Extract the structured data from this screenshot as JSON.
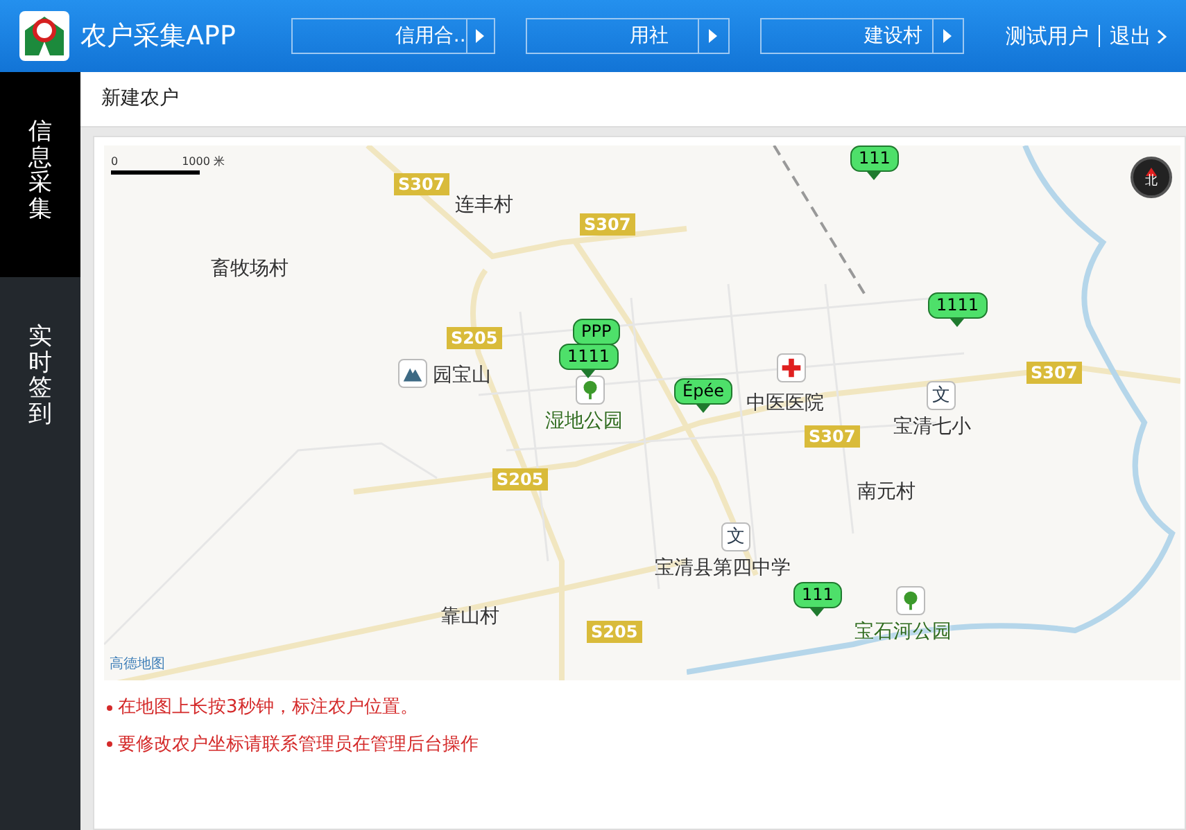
{
  "header": {
    "title": "农户采集APP",
    "selects": [
      {
        "value": "信用合.."
      },
      {
        "value": "用社"
      },
      {
        "value": "建设村"
      }
    ],
    "user": "测试用户",
    "logout": "退出"
  },
  "sidebar": {
    "items": [
      {
        "label": "信息采集",
        "selected": true
      },
      {
        "label": "实时签到",
        "selected": false
      }
    ]
  },
  "breadcrumb": "新建农户",
  "map": {
    "scale_start": "0",
    "scale_end": "1000 米",
    "compass": "北",
    "attribution": "高德地图",
    "road_labels": [
      "S307",
      "S307",
      "S205",
      "S205",
      "S205",
      "S307",
      "S307"
    ],
    "places": [
      {
        "name": "连丰村",
        "kind": "plain"
      },
      {
        "name": "畜牧场村",
        "kind": "plain"
      },
      {
        "name": "园宝山",
        "kind": "mountain"
      },
      {
        "name": "湿地公园",
        "kind": "park"
      },
      {
        "name": "中医医院",
        "kind": "hospital"
      },
      {
        "name": "宝清七小",
        "kind": "school",
        "icon_text": "文"
      },
      {
        "name": "南元村",
        "kind": "plain"
      },
      {
        "name": "宝清县第四中学",
        "kind": "school",
        "icon_text": "文"
      },
      {
        "name": "宝石河公园",
        "kind": "park"
      },
      {
        "name": "靠山村",
        "kind": "plain"
      }
    ],
    "markers": [
      "111",
      "1111",
      "PPP",
      "1111",
      "Épée",
      "111"
    ]
  },
  "notes": [
    "在地图上长按3秒钟，标注农户位置。",
    "要修改农户坐标请联系管理员在管理后台操作"
  ]
}
